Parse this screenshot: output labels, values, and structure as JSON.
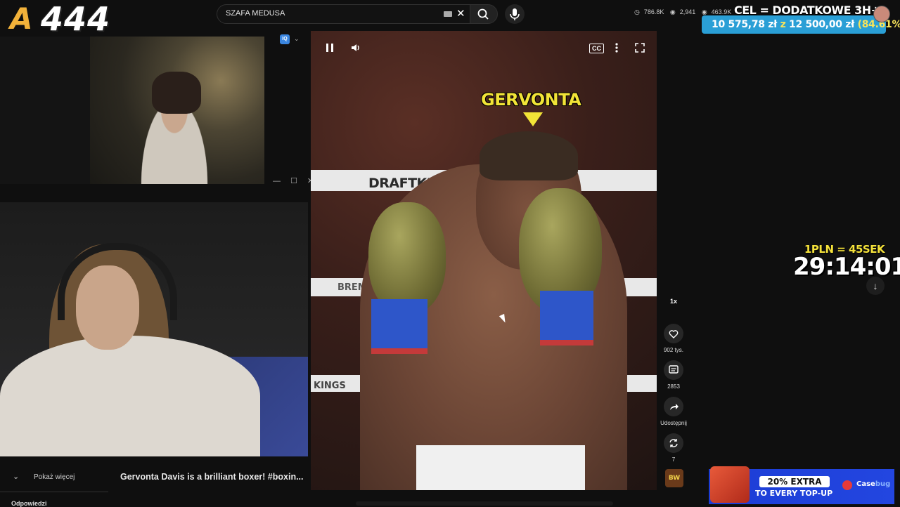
{
  "header": {
    "logo_letter": "A",
    "logo_number": "444",
    "search": {
      "value": "SZAFA MEDUSA"
    },
    "icons": {
      "clear": "close-icon",
      "search": "search-icon",
      "mic": "mic-icon"
    }
  },
  "stream_stats": {
    "views": "786.8K",
    "likes": "2,941",
    "viewers": "463.9K"
  },
  "goal": {
    "title": "CEL = DODATKOWE 3H+",
    "current": "10 575,78 zł",
    "separator": "z",
    "target": "12 500,00 zł",
    "percent_text": "(84.61%)",
    "percent": 84.61
  },
  "video": {
    "name_label": "GERVONTA",
    "sponsor_text": "DRAFTKINGS",
    "ring_text": "BREMA",
    "ring_text_low": "KINGS",
    "controls": {
      "pause": "pause-icon",
      "volume": "volume-icon",
      "cc": "CC",
      "more": "more-vertical-icon",
      "fullscreen": "fullscreen-icon"
    }
  },
  "extension": {
    "badge": "IQ"
  },
  "actions": {
    "speed": "1x",
    "likes": "902 tys.",
    "comments": "2853",
    "share": "Udostępnij",
    "remix": "7",
    "channel_badge": "BW"
  },
  "overlay": {
    "rate": "1PLN = 45SEK",
    "timer": "29:14:01"
  },
  "bottom": {
    "show_more": "Pokaż więcej",
    "video_title": "Gervonta Davis is a brilliant boxer! #boxin...",
    "replies": "Odpowiedzi"
  },
  "promo": {
    "headline": "20% EXTRA",
    "subline": "TO EVERY TOP-UP",
    "brand_a": "Case",
    "brand_b": "bug"
  },
  "colors": {
    "accent_yellow": "#f2e437",
    "goal_blue": "#2a9fd6",
    "promo_blue": "#2346e0"
  }
}
